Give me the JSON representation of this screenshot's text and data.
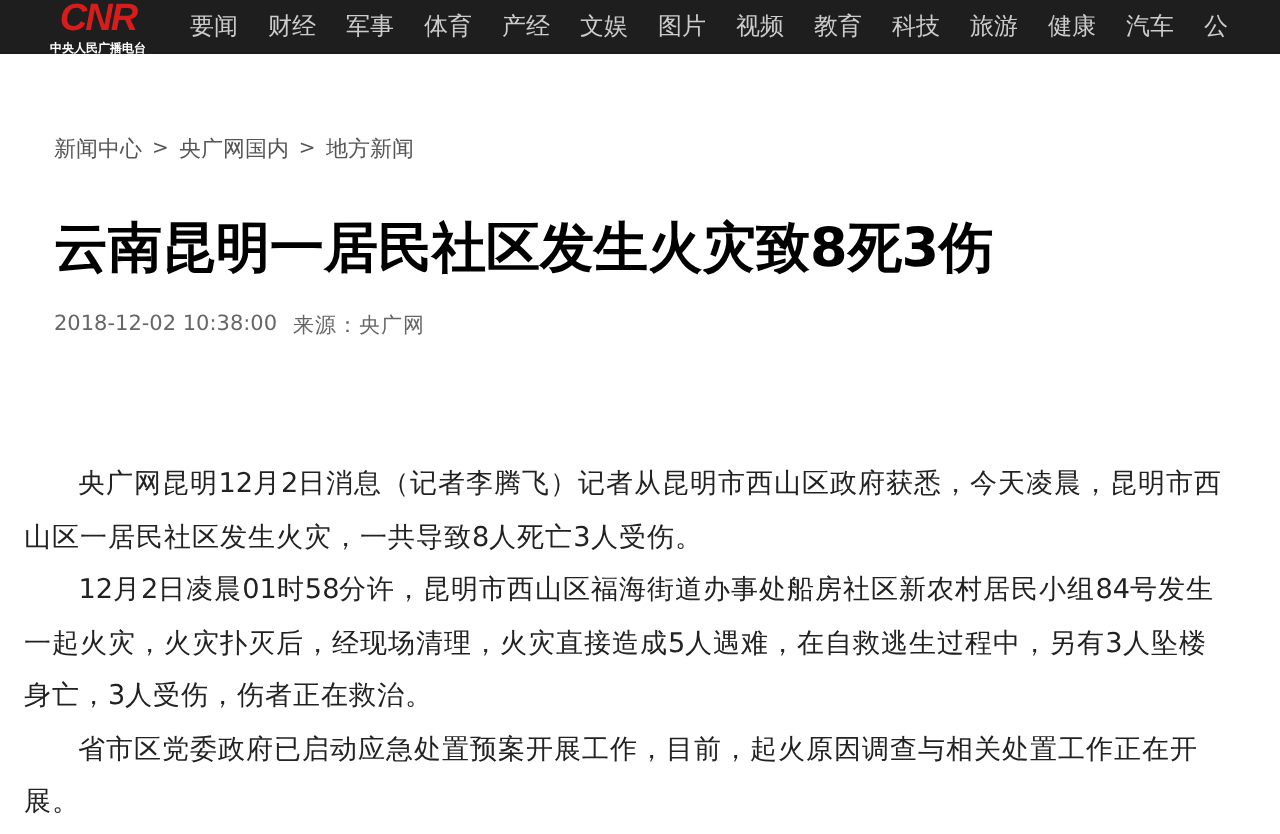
{
  "header": {
    "logo": "CNR",
    "logo_subtitle": "中央人民广播电台",
    "nav": [
      "要闻",
      "财经",
      "军事",
      "体育",
      "产经",
      "文娱",
      "图片",
      "视频",
      "教育",
      "科技",
      "旅游",
      "健康",
      "汽车",
      "公"
    ]
  },
  "breadcrumb": [
    "新闻中心",
    "央广网国内",
    "地方新闻"
  ],
  "breadcrumb_separator": ">",
  "article": {
    "title": "云南昆明一居民社区发生火灾致8死3伤",
    "date": "2018-12-02 10:38:00",
    "source": "来源：央广网",
    "paragraphs": [
      "央广网昆明12月2日消息（记者李腾飞）记者从昆明市西山区政府获悉，今天凌晨，昆明市西山区一居民社区发生火灾，一共导致8人死亡3人受伤。",
      "12月2日凌晨01时58分许，昆明市西山区福海街道办事处船房社区新农村居民小组84号发生一起火灾，火灾扑灭后，经现场清理，火灾直接造成5人遇难，在自救逃生过程中，另有3人坠楼身亡，3人受伤，伤者正在救治。",
      "省市区党委政府已启动应急处置预案开展工作，目前，起火原因调查与相关处置工作正在开展。"
    ]
  }
}
